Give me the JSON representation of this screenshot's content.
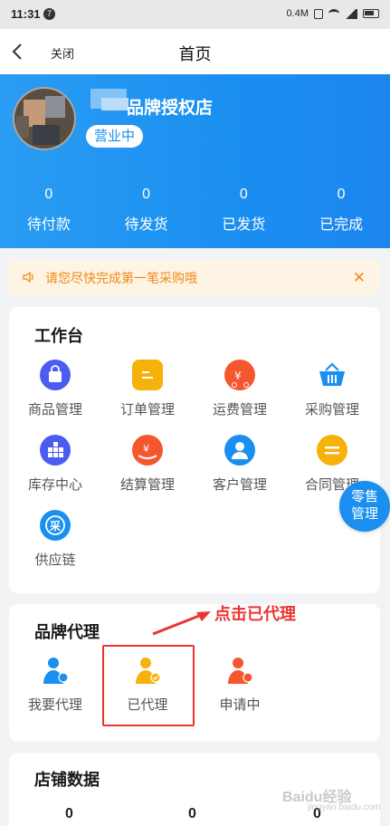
{
  "status_bar": {
    "time": "11:31",
    "notif_letter": "7",
    "network_speed": "0.4M"
  },
  "nav": {
    "close_label": "关闭",
    "title": "首页"
  },
  "shop": {
    "name": "品牌授权店",
    "status": "营业中"
  },
  "order_stats": [
    {
      "count": "0",
      "label": "待付款"
    },
    {
      "count": "0",
      "label": "待发货"
    },
    {
      "count": "0",
      "label": "已发货"
    },
    {
      "count": "0",
      "label": "已完成"
    }
  ],
  "notice": {
    "text": "请您尽快完成第一笔采购哦",
    "close_symbol": "✕"
  },
  "workbench": {
    "title": "工作台",
    "items": [
      {
        "label": "商品管理",
        "icon": "shopping-bag-icon",
        "color": "#4a5df0"
      },
      {
        "label": "订单管理",
        "icon": "order-list-icon",
        "color": "#f6b10a"
      },
      {
        "label": "运费管理",
        "icon": "delivery-truck-icon",
        "color": "#f5562e"
      },
      {
        "label": "采购管理",
        "icon": "basket-icon",
        "color": "#1a8ff0"
      },
      {
        "label": "库存中心",
        "icon": "inventory-blocks-icon",
        "color": "#4a5df0"
      },
      {
        "label": "结算管理",
        "icon": "settlement-hand-icon",
        "color": "#f5562e"
      },
      {
        "label": "客户管理",
        "icon": "customer-icon",
        "color": "#1a8ff0"
      },
      {
        "label": "合同管理",
        "icon": "contract-icon",
        "color": "#f6b10a"
      },
      {
        "label": "供应链",
        "icon": "supply-chain-icon",
        "color": "#1a8ff0",
        "glyph": "采"
      }
    ]
  },
  "floating_button": {
    "line1": "零售",
    "line2": "管理"
  },
  "brand_agent": {
    "title": "品牌代理",
    "items": [
      {
        "label": "我要代理",
        "icon": "agent-person-icon",
        "color": "#1a8ff0"
      },
      {
        "label": "已代理",
        "icon": "agent-done-person-icon",
        "color": "#f6b10a"
      },
      {
        "label": "申请中",
        "icon": "agent-pending-person-icon",
        "color": "#f5562e"
      }
    ]
  },
  "annotation": {
    "text": "点击已代理",
    "color": "#e33333"
  },
  "store_data": {
    "title": "店铺数据",
    "values": [
      "0",
      "0",
      "0"
    ]
  },
  "watermark": {
    "text": "Baidu经验",
    "sub": "jingyan.baidu.com"
  },
  "colors": {
    "primary": "#1a8ff0",
    "notice_bg": "#fdf4e3",
    "notice_text": "#f08a1a"
  }
}
